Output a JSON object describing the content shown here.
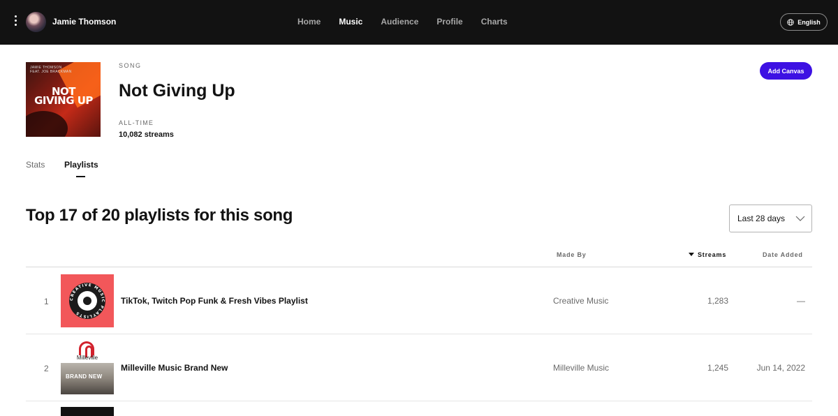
{
  "topbar": {
    "user_name": "Jamie Thomson",
    "nav": [
      "Home",
      "Music",
      "Audience",
      "Profile",
      "Charts"
    ],
    "active_nav": "Music",
    "language_label": "English"
  },
  "song": {
    "kicker": "SONG",
    "title": "Not Giving Up",
    "cover_artist_line1": "JAMIE THOMSON",
    "cover_artist_line2": "FEAT. JOE BRACKMAN",
    "cover_title": "NOT GIVING UP",
    "alltime_label": "ALL-TIME",
    "streams_total": "10,082 streams",
    "add_canvas_label": "Add Canvas"
  },
  "tabs": {
    "stats": "Stats",
    "playlists": "Playlists"
  },
  "section": {
    "title": "Top 17 of 20 playlists for this song",
    "range_selected": "Last 28 days"
  },
  "table": {
    "columns": {
      "made_by": "Made By",
      "streams": "Streams",
      "date_added": "Date Added"
    },
    "rows": [
      {
        "rank": "1",
        "name": "TikTok, Twitch Pop Funk & Fresh Vibes Playlist",
        "made_by": "Creative Music",
        "streams": "1,283",
        "date_added": "—",
        "thumb_text": "CREATIVE MUSIC PLAYLISTS"
      },
      {
        "rank": "2",
        "name": "Milleville Music Brand New",
        "made_by": "Milleville Music",
        "streams": "1,245",
        "date_added": "Jun 14, 2022",
        "thumb_brand": "Milleville",
        "thumb_text": "BRAND NEW"
      }
    ]
  },
  "colors": {
    "topbar_bg": "#121212",
    "accent": "#3d11e3",
    "creative_thumb": "#f2575a",
    "milleville_red": "#d2222d"
  }
}
